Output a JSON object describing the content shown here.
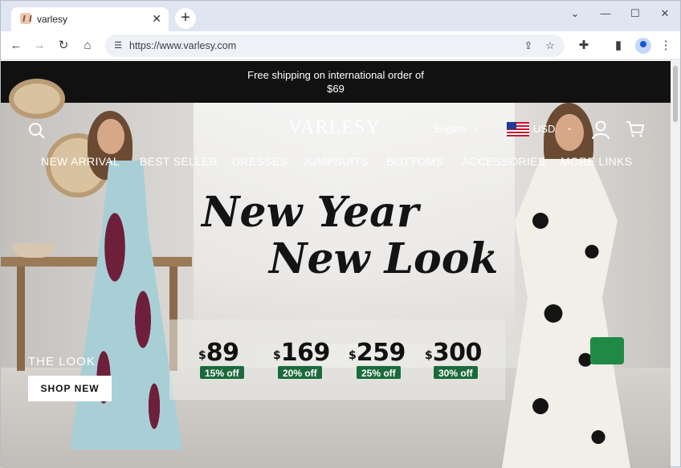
{
  "browser": {
    "tab_title": "varlesy",
    "tab_close": "✕",
    "new_tab": "+",
    "url": "https://www.varlesy.com",
    "window_controls": {
      "dropdown": "⌄",
      "minimize": "—",
      "maximize": "☐",
      "close": "✕"
    },
    "icons": {
      "back": "←",
      "forward": "→",
      "reload": "↻",
      "home": "⌂",
      "share": "⇪",
      "bookmark": "☆",
      "extensions": "✚",
      "sidepanel": "▮",
      "menu": "⋮",
      "site_info": "☰"
    }
  },
  "announcement": {
    "line1": "Free shipping on international order of",
    "line2": "$69"
  },
  "header": {
    "brand": "VARLESY",
    "language": "English",
    "currency": "USD",
    "chevron": "⌄"
  },
  "nav": {
    "items": [
      {
        "label": "NEW ARRIVAL"
      },
      {
        "label": "BEST SELLER"
      },
      {
        "label": "DRESSES"
      },
      {
        "label": "JUMPSUITS"
      },
      {
        "label": "BOTTOMS"
      },
      {
        "label": "ACCESSORIES"
      },
      {
        "label": "MORE LINKS"
      }
    ]
  },
  "hero": {
    "headline_line1": "New Year",
    "headline_line2": "New Look",
    "prices": [
      {
        "currency": "$",
        "amount": "89",
        "discount": "15% off"
      },
      {
        "currency": "$",
        "amount": "169",
        "discount": "20% off"
      },
      {
        "currency": "$",
        "amount": "259",
        "discount": "25% off"
      },
      {
        "currency": "$",
        "amount": "300",
        "discount": "30% off"
      }
    ],
    "caption": "THE LOOK",
    "cta": "SHOP NEW"
  },
  "colors": {
    "announce_bg": "#111111",
    "badge_green": "#1c6a3c",
    "text_white": "#ffffff"
  }
}
